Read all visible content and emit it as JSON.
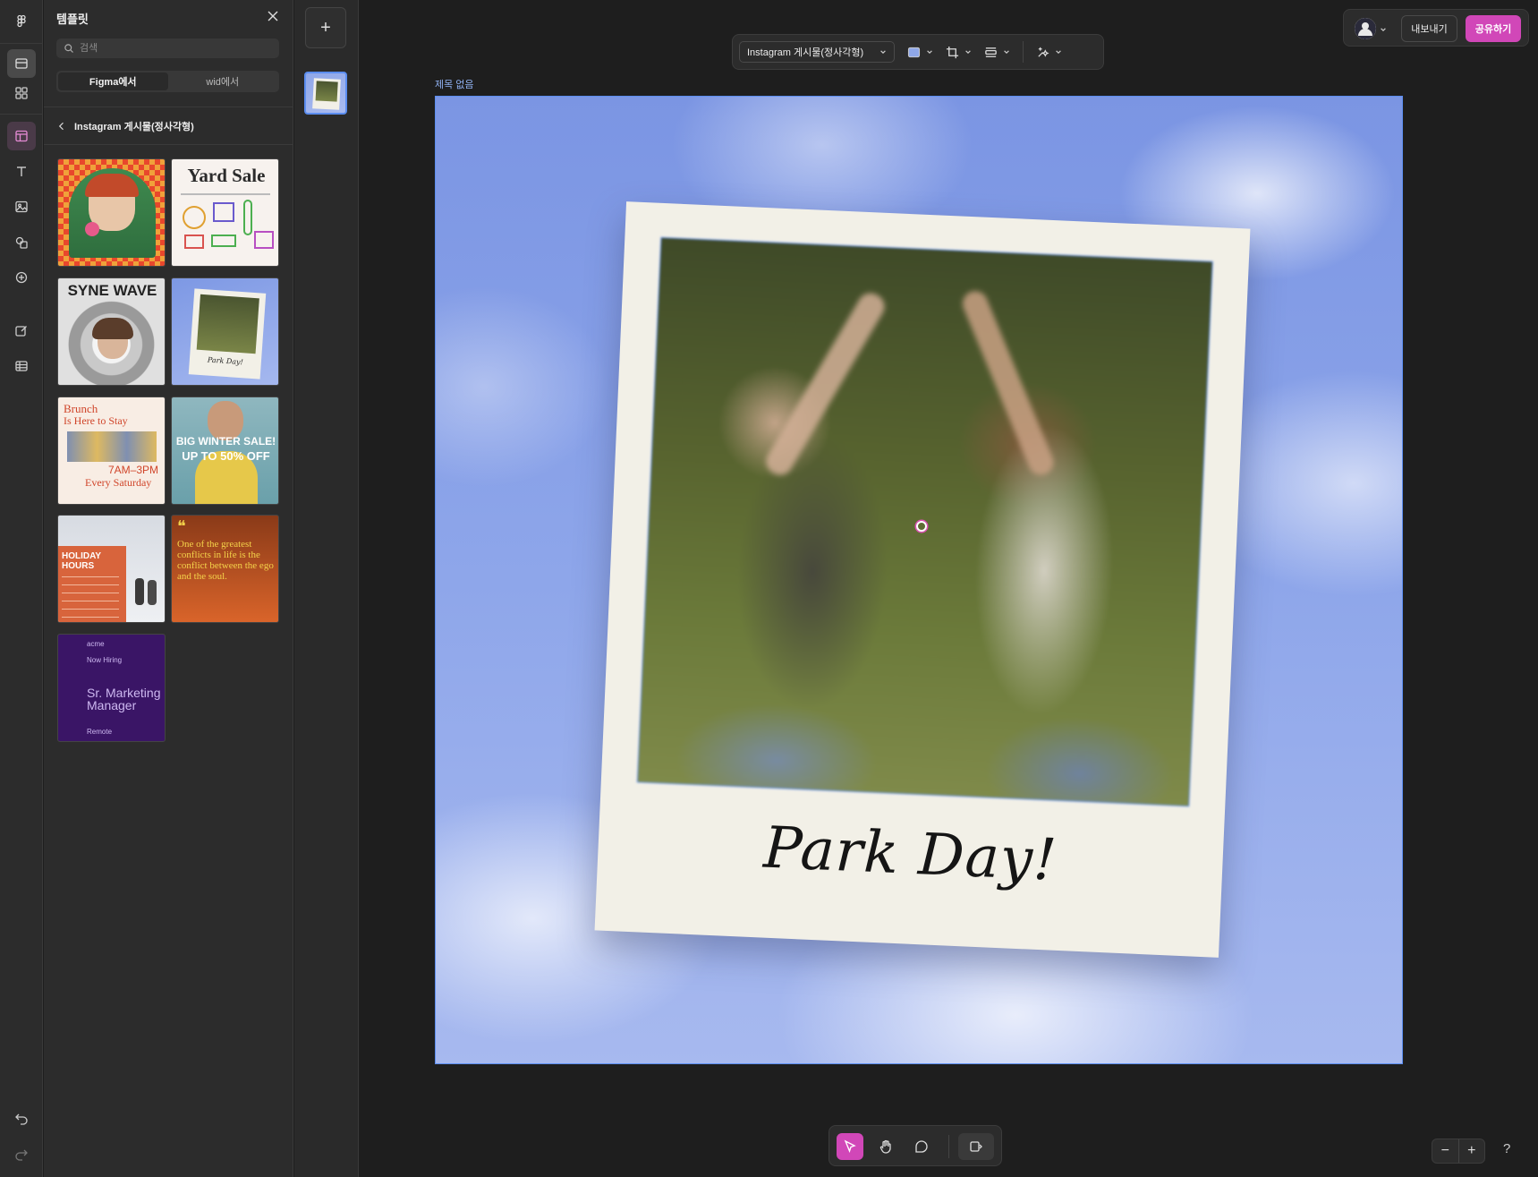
{
  "templates_panel": {
    "title": "템플릿",
    "search_placeholder": "검색",
    "tabs": [
      {
        "label": "Figma에서",
        "selected": true
      },
      {
        "label": "wid에서",
        "selected": false
      }
    ],
    "breadcrumb": "Instagram 게시물(정사각형)",
    "thumbnails": {
      "yard_sale": "Yard Sale",
      "syne_wave": "SYNE WAVE",
      "park_day_small": "Park Day!",
      "brunch_line1": "Brunch",
      "brunch_line2": "Is Here to Stay",
      "brunch_time": "7AM–3PM",
      "brunch_day": "Every Saturday",
      "winter_line1": "BIG WINTER SALE!",
      "winter_line2": "UP TO 50% OFF",
      "holiday_line1": "HOLIDAY",
      "holiday_line2": "HOURS",
      "quote_mark": "❝",
      "quote": "One of the greatest conflicts in life is the conflict between the ego and the soul.",
      "hiring_brand": "acme",
      "hiring_label": "Now Hiring",
      "hiring_role": "Sr. Marketing Manager",
      "hiring_location": "Remote"
    }
  },
  "pages": {
    "add_label": "+"
  },
  "toolbar": {
    "format_select": "Instagram 게시물(정사각형)"
  },
  "canvas": {
    "frame_label": "제목 없음",
    "caption": "Park Day!"
  },
  "top_right": {
    "export_label": "내보내기",
    "share_label": "공유하기"
  },
  "zoom": {
    "minus": "−",
    "plus": "+"
  },
  "help_label": "?",
  "colors": {
    "accent_pink": "#d147b8",
    "selection_blue": "#5b8def",
    "panel_bg": "#2c2c2c",
    "canvas_bg": "#1e1e1e"
  }
}
